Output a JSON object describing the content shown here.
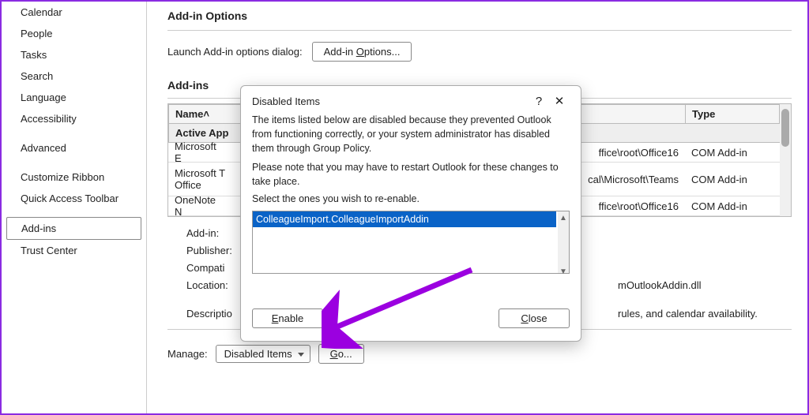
{
  "sidebar": {
    "items": [
      "Calendar",
      "People",
      "Tasks",
      "Search",
      "Language",
      "Accessibility",
      "Advanced",
      "Customize Ribbon",
      "Quick Access Toolbar",
      "Add-ins",
      "Trust Center"
    ],
    "selected": "Add-ins"
  },
  "main": {
    "section_title": "Add-in Options",
    "launch_label": "Launch Add-in options dialog:",
    "launch_button": "Add-in Options...",
    "addins_title": "Add-ins",
    "table": {
      "col_name": "Name˄",
      "col_type": "Type",
      "group1": "Active App",
      "rows": [
        {
          "name": "Microsoft E",
          "loc": "ffice\\root\\Office16",
          "type": "COM Add-in",
          "tall": false
        },
        {
          "name": "Microsoft T\nOffice",
          "loc": "cal\\Microsoft\\Teams",
          "type": "COM Add-in",
          "tall": true
        },
        {
          "name": "OneNote N",
          "loc": "ffice\\root\\Office16",
          "type": "COM Add-in",
          "tall": false
        }
      ]
    },
    "details": {
      "addin_label": "Add-in:",
      "publisher_label": "Publisher:",
      "compat_label": "Compati",
      "location_label": "Location:",
      "location_value": "mOutlookAddin.dll",
      "description_label": "Descriptio",
      "description_value": "rules, and calendar availability."
    },
    "manage": {
      "label": "Manage:",
      "value": "Disabled Items",
      "go": "Go..."
    }
  },
  "dialog": {
    "title": "Disabled Items",
    "help": "?",
    "close_icon": "✕",
    "p1": "The items listed below are disabled because they prevented Outlook from functioning correctly, or your system administrator has disabled them through Group Policy.",
    "p2": "Please note that you may have to restart Outlook for these changes to take place.",
    "p3": "Select the ones you wish to re-enable.",
    "list_item": "ColleagueImport.ColleagueImportAddin",
    "enable": "Enable",
    "close": "Close"
  }
}
